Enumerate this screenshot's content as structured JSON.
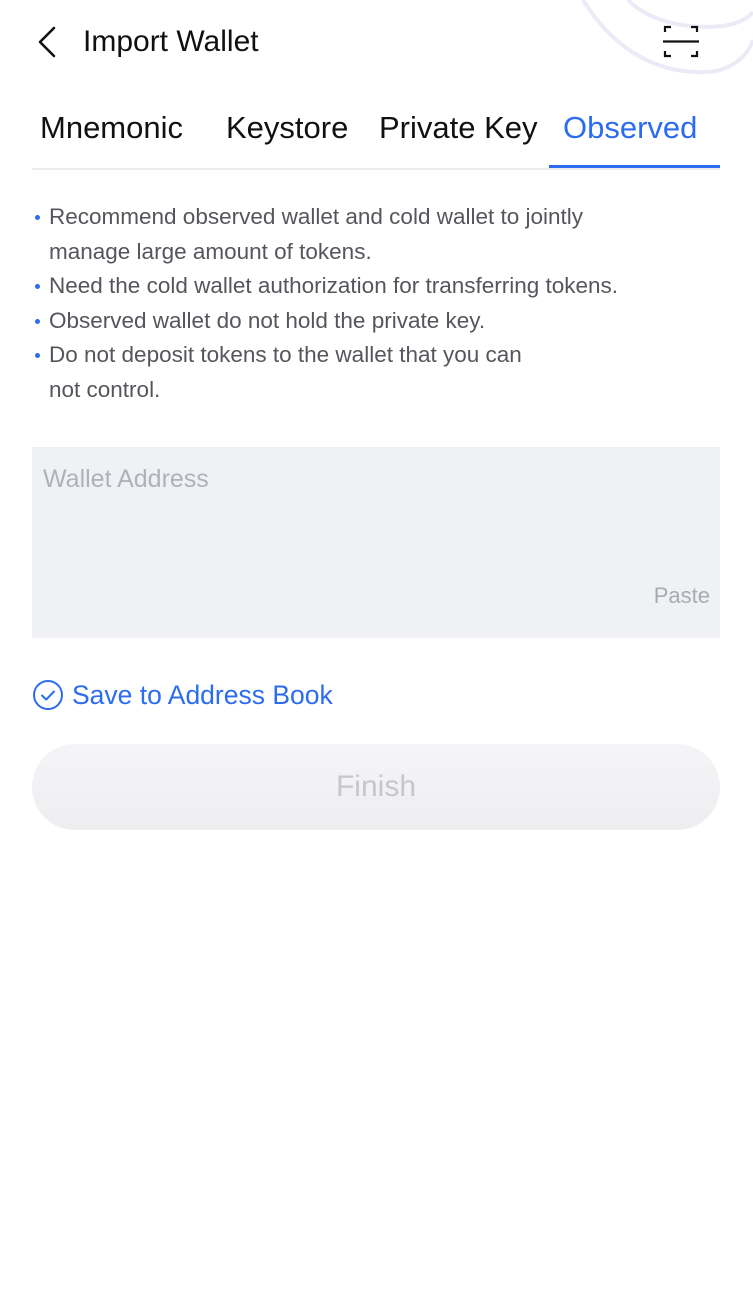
{
  "header": {
    "title": "Import Wallet",
    "back_icon": "chevron-left-icon",
    "scan_icon": "scan-icon"
  },
  "tabs": [
    {
      "label": "Mnemonic",
      "active": false
    },
    {
      "label": "Keystore",
      "active": false
    },
    {
      "label": "Private Key",
      "active": false
    },
    {
      "label": "Observed",
      "active": true
    }
  ],
  "tips": [
    [
      "Recommend observed wallet and cold wallet to jointly",
      "manage large amount of tokens."
    ],
    [
      "Need the cold wallet authorization for transferring tokens."
    ],
    [
      "Observed wallet do not hold the private key."
    ],
    [
      "Do not deposit tokens to the wallet that you can",
      "not control."
    ]
  ],
  "address": {
    "value": "",
    "placeholder": "Wallet Address",
    "paste_label": "Paste"
  },
  "save_to_address_book": {
    "label": "Save to Address Book",
    "checked": true,
    "icon": "check-circle-icon"
  },
  "finish": {
    "label": "Finish",
    "enabled": false
  },
  "colors": {
    "accent": "#2c6cf0",
    "input_bg": "#f0f1f5",
    "tip_text": "#55565c",
    "disabled_text": "#c6c7cc"
  }
}
